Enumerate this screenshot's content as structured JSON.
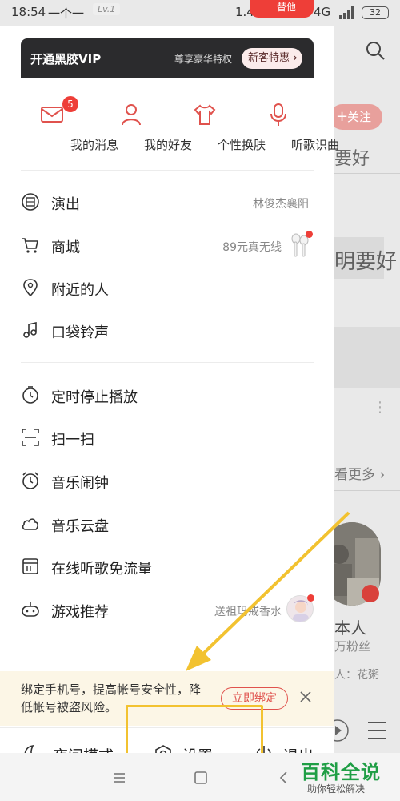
{
  "status_bar": {
    "time": "18:54",
    "username": "一个一",
    "level": "Lv.1",
    "net_speed": "1.4K/s",
    "red_pill": "替他",
    "network": "4G",
    "battery": "32"
  },
  "background": {
    "follow_button": "关注",
    "text1": "要好",
    "text2": "明要好",
    "see_more": "看更多",
    "artist_name": "本人",
    "fans": "万粉丝",
    "small_text": "人：花粥"
  },
  "drawer": {
    "vip": {
      "title": "开通黑胶VIP",
      "perk": "尊享豪华特权",
      "button": "新客特惠"
    },
    "quick": [
      {
        "label": "我的消息",
        "icon": "envelope-icon",
        "badge": "5"
      },
      {
        "label": "我的好友",
        "icon": "person-icon"
      },
      {
        "label": "个性换肤",
        "icon": "tshirt-icon"
      },
      {
        "label": "听歌识曲",
        "icon": "microphone-icon"
      }
    ],
    "menu_group1": [
      {
        "label": "演出",
        "icon": "ticket-icon",
        "right": "林俊杰襄阳"
      },
      {
        "label": "商城",
        "icon": "cart-icon",
        "right": "89元真无线"
      },
      {
        "label": "附近的人",
        "icon": "location-pin-icon"
      },
      {
        "label": "口袋铃声",
        "icon": "ringtone-icon"
      }
    ],
    "menu_group2": [
      {
        "label": "定时停止播放",
        "icon": "timer-icon"
      },
      {
        "label": "扫一扫",
        "icon": "scan-icon"
      },
      {
        "label": "音乐闹钟",
        "icon": "alarm-clock-icon"
      },
      {
        "label": "音乐云盘",
        "icon": "cloud-icon"
      },
      {
        "label": "在线听歌免流量",
        "icon": "sim-card-icon"
      },
      {
        "label": "游戏推荐",
        "icon": "game-controller-icon",
        "right": "送祖玛戒香水"
      }
    ],
    "toast": {
      "text": "绑定手机号，提高帐号安全性，降低帐号被盗风险。",
      "button": "立即绑定"
    },
    "bottom": {
      "night_mode": "夜间模式",
      "settings": "设置",
      "logout": "退出"
    }
  },
  "watermark": {
    "main": "百科全说",
    "sub": "助你轻松解决"
  },
  "colors": {
    "accent_red": "#ee3e38",
    "vip_dark": "#2b2b2d",
    "highlight_yellow": "#f2c230",
    "watermark_green": "#1f9e45"
  }
}
